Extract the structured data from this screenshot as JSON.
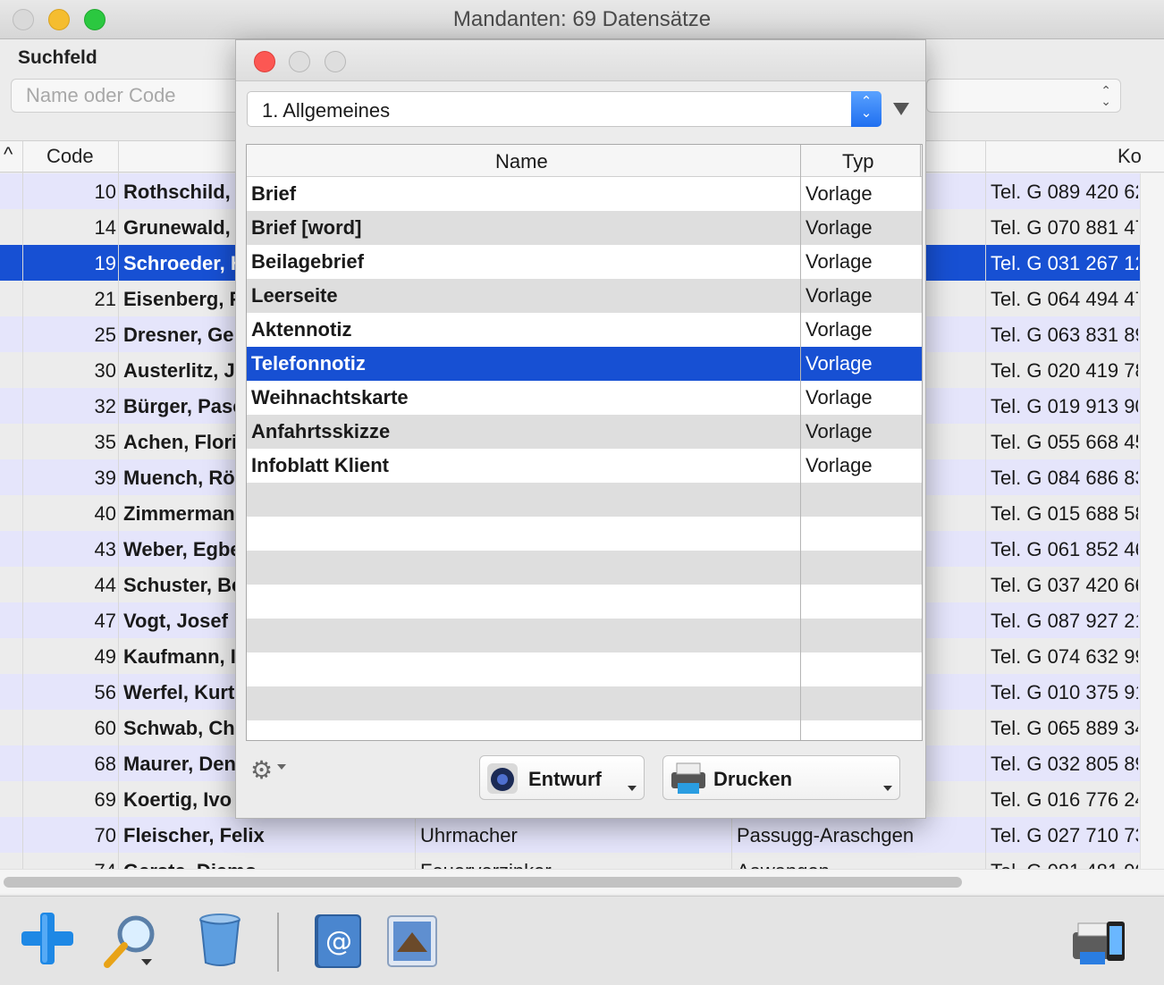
{
  "window": {
    "title": "Mandanten: 69 Datensätze"
  },
  "search": {
    "label": "Suchfeld",
    "placeholder": "Name oder Code"
  },
  "table": {
    "headers": {
      "code": "Code",
      "contact": "Ko"
    },
    "rows": [
      {
        "code": "10",
        "name": "Rothschild,",
        "job": "",
        "place": "",
        "tel": "Tel. G 089 420 62"
      },
      {
        "code": "14",
        "name": "Grunewald,",
        "job": "",
        "place": "",
        "tel": "Tel. G 070 881 47"
      },
      {
        "code": "19",
        "name": "Schroeder, H",
        "job": "",
        "place": "",
        "tel": "Tel. G 031 267 12"
      },
      {
        "code": "21",
        "name": "Eisenberg, F",
        "job": "",
        "place": "",
        "tel": "Tel. G 064 494 47"
      },
      {
        "code": "25",
        "name": "Dresner, Ger",
        "job": "",
        "place": "",
        "tel": "Tel. G 063 831 89"
      },
      {
        "code": "30",
        "name": "Austerlitz, Ja",
        "job": "",
        "place": "",
        "tel": "Tel. G 020 419 78"
      },
      {
        "code": "32",
        "name": "Bürger, Pasc",
        "job": "",
        "place": "",
        "tel": "Tel. G 019 913 90"
      },
      {
        "code": "35",
        "name": "Achen, Flori",
        "job": "",
        "place": "",
        "tel": "Tel. G 055 668 45"
      },
      {
        "code": "39",
        "name": "Muench, Rö",
        "job": "",
        "place": "",
        "tel": "Tel. G 084 686 83"
      },
      {
        "code": "40",
        "name": "Zimmerman",
        "job": "",
        "place": "",
        "tel": "Tel. G 015 688 58"
      },
      {
        "code": "43",
        "name": "Weber, Egbe",
        "job": "",
        "place": "",
        "tel": "Tel. G 061 852 46"
      },
      {
        "code": "44",
        "name": "Schuster, Be",
        "job": "",
        "place": "",
        "tel": "Tel. G 037 420 66"
      },
      {
        "code": "47",
        "name": "Vogt, Josef",
        "job": "",
        "place": "",
        "tel": "Tel. G 087 927 21"
      },
      {
        "code": "49",
        "name": "Kaufmann, I",
        "job": "",
        "place": "",
        "tel": "Tel. G 074 632 99"
      },
      {
        "code": "56",
        "name": "Werfel, Kurt",
        "job": "",
        "place": "",
        "tel": "Tel. G 010 375 91"
      },
      {
        "code": "60",
        "name": "Schwab, Ch",
        "job": "",
        "place": "",
        "tel": "Tel. G 065 889 34"
      },
      {
        "code": "68",
        "name": "Maurer, Den",
        "job": "",
        "place": "",
        "tel": "Tel. G 032 805 89"
      },
      {
        "code": "69",
        "name": "Koertig, Ivo",
        "job": "",
        "place": "",
        "tel": "Tel. G 016 776 24"
      },
      {
        "code": "70",
        "name": "Fleischer, Felix",
        "job": "Uhrmacher",
        "place": "Passugg-Araschgen",
        "tel": "Tel. G 027 710 73"
      },
      {
        "code": "74",
        "name": "Gerste, Diemo",
        "job": "Feuerverzinker",
        "place": "Aawangen",
        "tel": "Tel. G 081 481 90"
      }
    ]
  },
  "panel": {
    "select": {
      "value": "1. Allgemeines"
    },
    "headers": {
      "name": "Name",
      "typ": "Typ"
    },
    "rows": [
      {
        "name": "Brief",
        "typ": "Vorlage"
      },
      {
        "name": "Brief [word]",
        "typ": "Vorlage"
      },
      {
        "name": "Beilagebrief",
        "typ": "Vorlage"
      },
      {
        "name": "Leerseite",
        "typ": "Vorlage"
      },
      {
        "name": "Aktennotiz",
        "typ": "Vorlage"
      },
      {
        "name": "Telefonnotiz",
        "typ": "Vorlage"
      },
      {
        "name": "Weihnachtskarte",
        "typ": "Vorlage"
      },
      {
        "name": "Anfahrtsskizze",
        "typ": "Vorlage"
      },
      {
        "name": "Infoblatt Klient",
        "typ": "Vorlage"
      }
    ],
    "empty_rows": 8,
    "buttons": {
      "draft": "Entwurf",
      "print": "Drucken"
    }
  },
  "colors": {
    "selection": "#1750d3",
    "alt_row": "#e5e5fb"
  }
}
